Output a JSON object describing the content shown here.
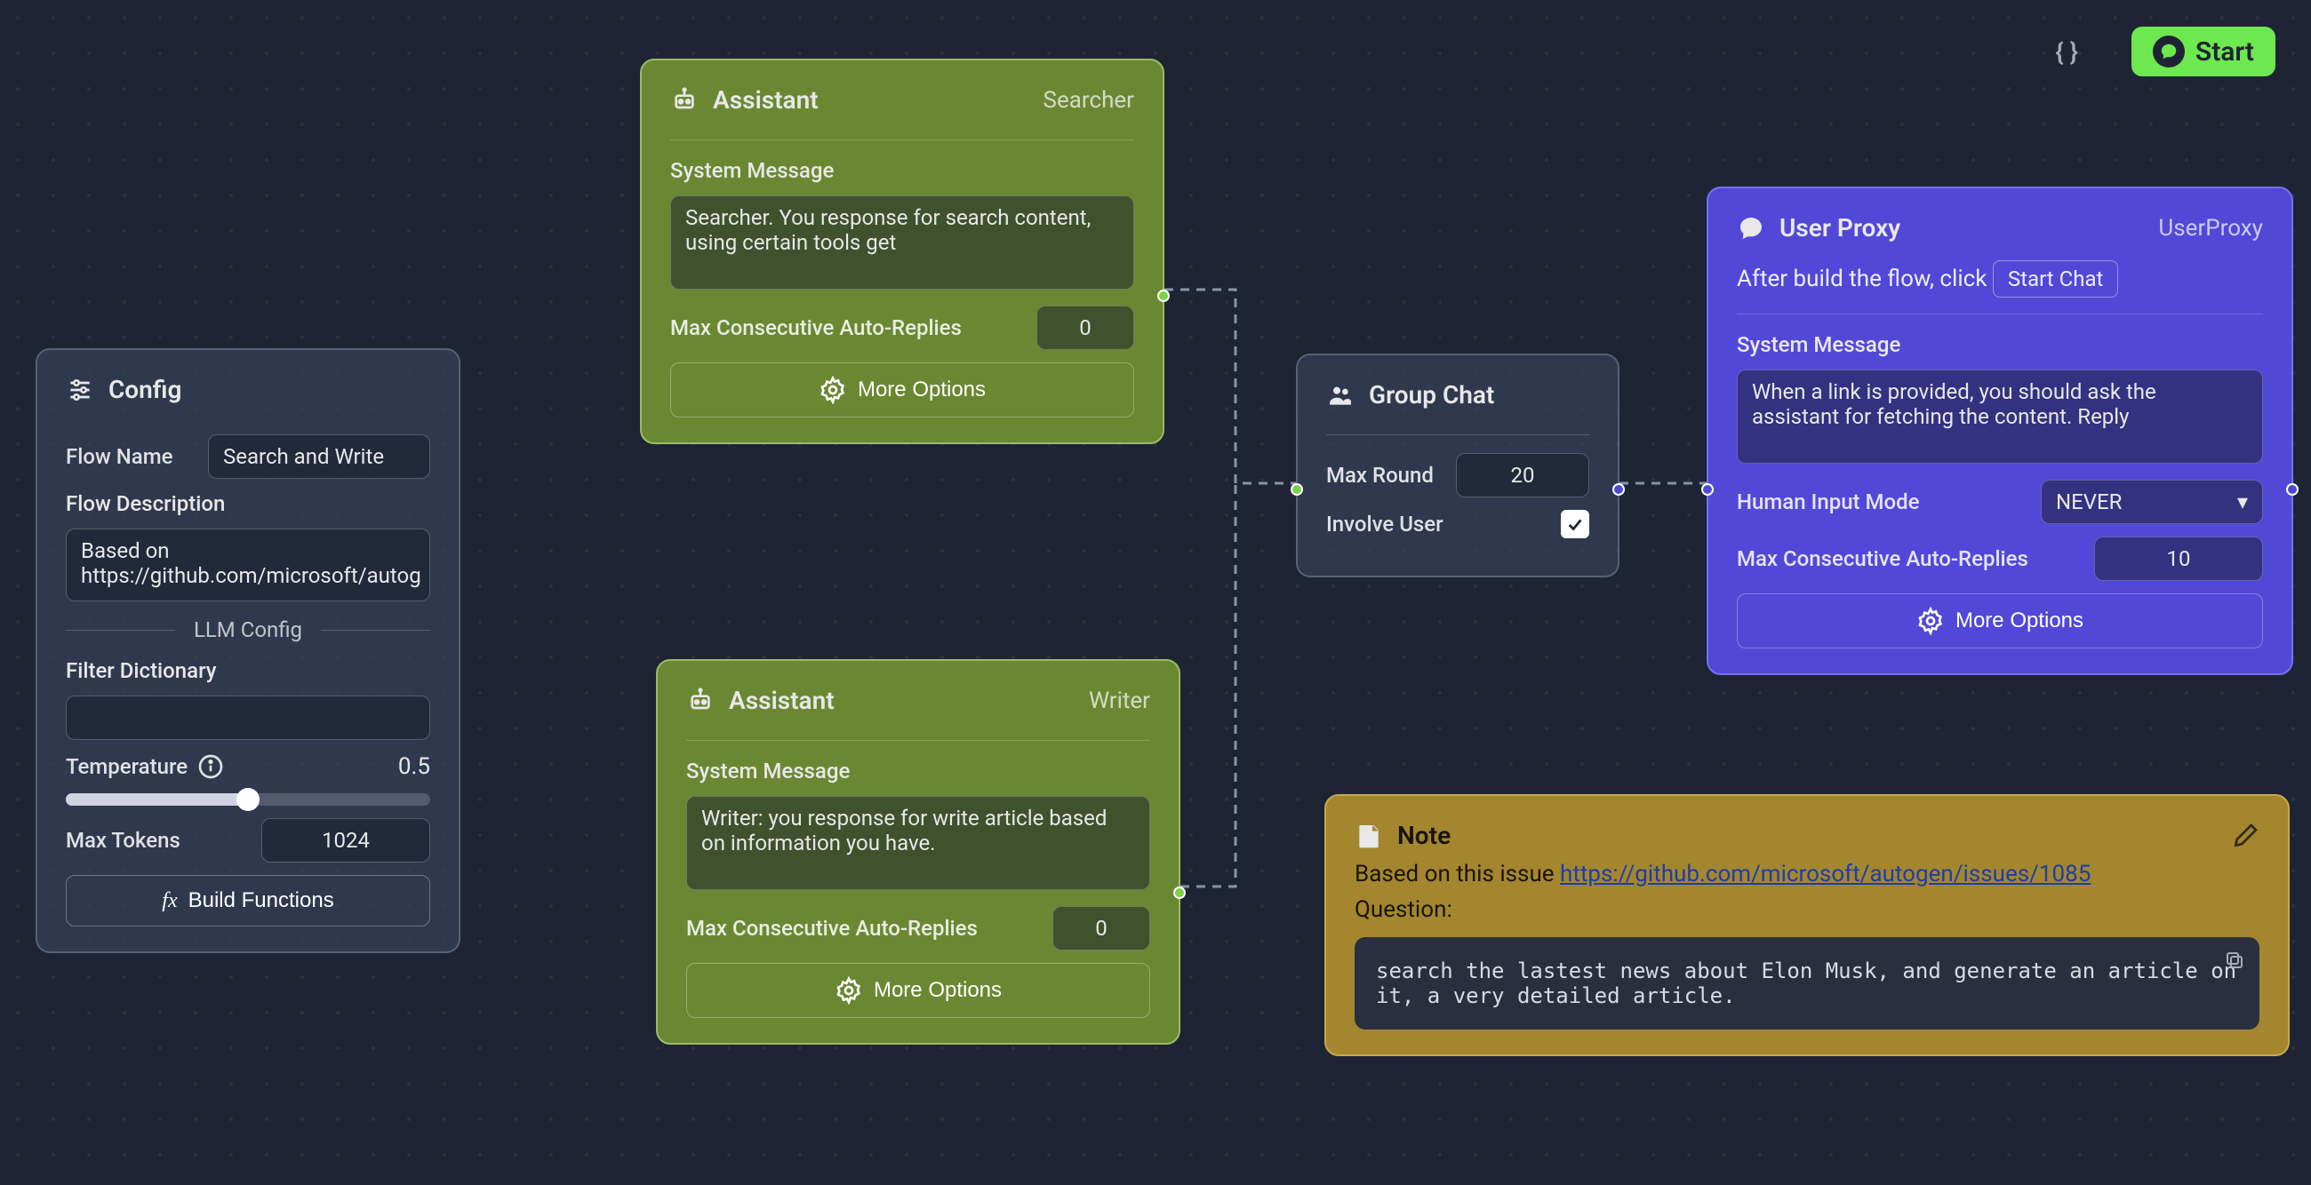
{
  "toolbar": {
    "start_label": "Start"
  },
  "config": {
    "title": "Config",
    "flow_name_label": "Flow Name",
    "flow_name_value": "Search and Write",
    "flow_description_label": "Flow Description",
    "flow_description_value": "Based on https://github.com/microsoft/autog",
    "llm_config_label": "LLM Config",
    "filter_dictionary_label": "Filter Dictionary",
    "filter_dictionary_value": "",
    "temperature_label": "Temperature",
    "temperature_value": "0.5",
    "max_tokens_label": "Max Tokens",
    "max_tokens_value": "1024",
    "build_functions_label": "Build Functions"
  },
  "assistant1": {
    "type_label": "Assistant",
    "name": "Searcher",
    "system_message_label": "System Message",
    "system_message_value": "Searcher. You response for search content, using certain tools get",
    "max_auto_replies_label": "Max Consecutive Auto-Replies",
    "max_auto_replies_value": "0",
    "more_options_label": "More Options"
  },
  "assistant2": {
    "type_label": "Assistant",
    "name": "Writer",
    "system_message_label": "System Message",
    "system_message_value": "Writer: you response for write article based on information you have.",
    "max_auto_replies_label": "Max Consecutive Auto-Replies",
    "max_auto_replies_value": "0",
    "more_options_label": "More Options"
  },
  "groupchat": {
    "title": "Group Chat",
    "max_round_label": "Max Round",
    "max_round_value": "20",
    "involve_user_label": "Involve User",
    "involve_user_checked": true
  },
  "userproxy": {
    "type_label": "User Proxy",
    "name": "UserProxy",
    "hint_text": "After build the flow, click",
    "hint_chip": "Start Chat",
    "system_message_label": "System Message",
    "system_message_value": "When a link is provided, you should ask the assistant for fetching the content. Reply",
    "human_input_mode_label": "Human Input Mode",
    "human_input_mode_value": "NEVER",
    "max_auto_replies_label": "Max Consecutive Auto-Replies",
    "max_auto_replies_value": "10",
    "more_options_label": "More Options"
  },
  "note": {
    "title": "Note",
    "prefix": "Based on this issue ",
    "link": "https://github.com/microsoft/autogen/issues/1085",
    "question_label": "Question:",
    "code": "search the lastest news about Elon Musk, and generate an article on it, a very detailed article."
  }
}
